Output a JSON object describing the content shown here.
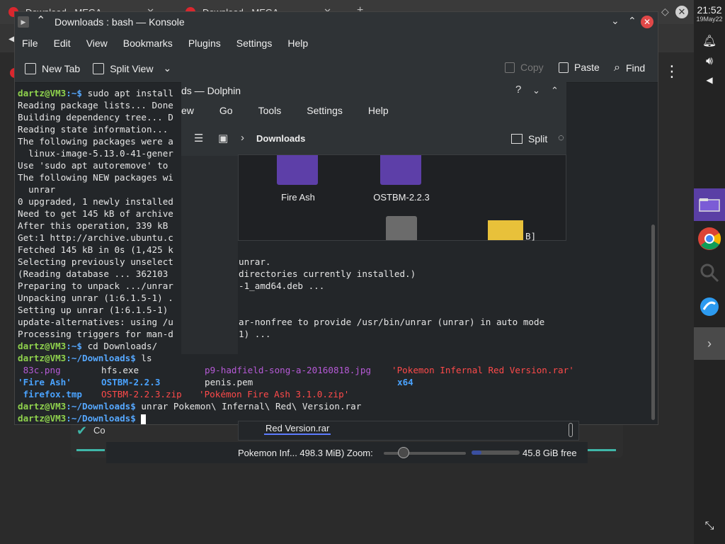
{
  "browser": {
    "tab1_label": "Download - MEGA",
    "tab2_label": "Download - MEGA",
    "download_label": "Co"
  },
  "clock": {
    "time": "21:52",
    "date": "19May22"
  },
  "konsole": {
    "title": "Downloads : bash — Konsole",
    "menu": [
      "File",
      "Edit",
      "View",
      "Bookmarks",
      "Plugins",
      "Settings",
      "Help"
    ],
    "toolbar": {
      "new_tab": "New Tab",
      "split_view": "Split View",
      "copy": "Copy",
      "paste": "Paste",
      "find": "Find"
    },
    "terminal_lines": [
      "sudo apt install",
      "Reading package lists... Done",
      "Building dependency tree... D",
      "Reading state information...",
      "The following packages were a",
      "  linux-image-5.13.0-41-gener",
      "Use 'sudo apt autoremove' to",
      "The following NEW packages wi",
      "  unrar",
      "0 upgraded, 1 newly installed",
      "Need to get 145 kB of archive",
      "After this operation, 339 kB",
      "Get:1 http://archive.ubuntu.c",
      "Fetched 145 kB in 0s (1,425 k",
      "Selecting previously unselect",
      "(Reading database ... 362103",
      "Preparing to unpack .../unrar",
      "Unpacking unrar (1:6.1.5-1) .",
      "Setting up unrar (1:6.1.5-1)",
      "update-alternatives: using /u",
      "Processing triggers for man-d"
    ],
    "terminal_right": [
      "unrar.",
      "directories currently installed.)",
      "-1_amd64.deb ...",
      "ar-nonfree to provide /usr/bin/unrar (unrar) in auto mode",
      "1) ..."
    ],
    "prompt_user": "dartz@VM3",
    "prompt_home": ":~$ ",
    "prompt_downloads": ":~/Downloads$ ",
    "cmd_cd": "cd Downloads/",
    "cmd_ls": "ls",
    "cmd_unrar": "unrar Pokemon\\ Infernal\\ Red\\ Version.rar",
    "ls_output": {
      "r1c1": " 83c.png",
      "r1c2": "hfs.exe",
      "r1c3": "p9-hadfield-song-a-20160818.jpg",
      "r1c4": "'Pokemon Infernal Red Version.rar'",
      "r2c1": "'Fire Ash'",
      "r2c2": "OSTBM-2.2.3",
      "r2c3": "penis.pem",
      "r2c4": "x64",
      "r3c1": " firefox.tmp",
      "r3c2": "OSTBM-2.2.3.zip",
      "r3c3": "'Pokémon Fire Ash 3.1.0.zip'"
    }
  },
  "dolphin": {
    "title": "ds — Dolphin",
    "menu": [
      "ew",
      "Go",
      "Tools",
      "Settings",
      "Help"
    ],
    "breadcrumb": "Downloads",
    "split": "Split",
    "files": [
      "Fire Ash",
      "OSTBM-2.2.3"
    ],
    "bracket": "B]",
    "selected_filename": "Red Version.rar",
    "status": "Pokemon Inf... 498.3 MiB) Zoom:",
    "free_space": "45.8 GiB free",
    "free_space_fraction": 0.2,
    "zoom_fraction": 0.25
  }
}
